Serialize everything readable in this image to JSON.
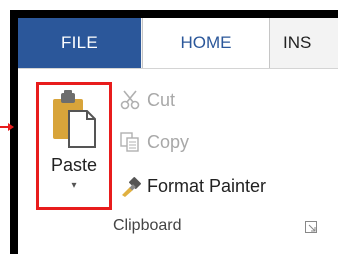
{
  "tabs": [
    {
      "label": "FILE"
    },
    {
      "label": "HOME"
    },
    {
      "label": "INS"
    }
  ],
  "clipboard": {
    "paste_label": "Paste",
    "paste_arrow": "▾",
    "cut_label": "Cut",
    "copy_label": "Copy",
    "format_painter_label": "Format Painter",
    "group_label": "Clipboard"
  },
  "colors": {
    "file_tab": "#2b579a",
    "highlight_border": "#e81c1c",
    "pointer": "#e81c1c"
  }
}
